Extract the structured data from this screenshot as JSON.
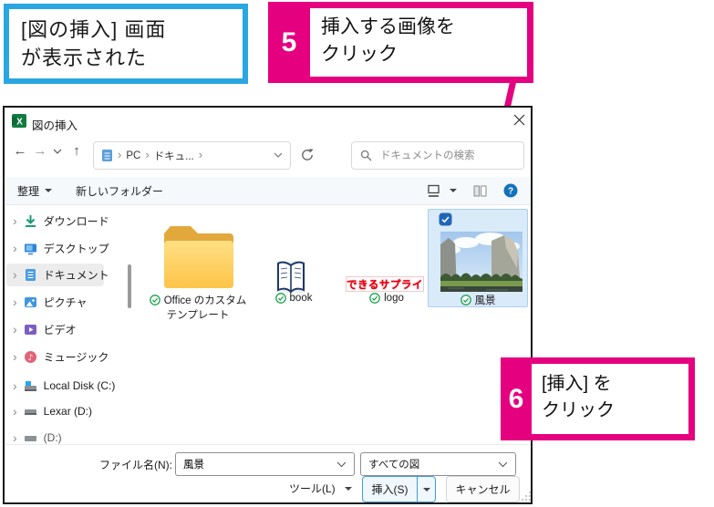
{
  "callout_note": {
    "line1": "[図の挿入] 画面",
    "line2": "が表示された"
  },
  "step5": {
    "number": "5",
    "line1": "挿入する画像を",
    "line2": "クリック"
  },
  "step6": {
    "number": "6",
    "line1": "[挿入] を",
    "line2": "クリック"
  },
  "dialog": {
    "title": "図の挿入",
    "nav": {
      "breadcrumb_root": "PC",
      "breadcrumb_folder": "ドキュ...",
      "search_placeholder": "ドキュメントの検索"
    },
    "toolbar": {
      "organize": "整理",
      "new_folder": "新しいフォルダー"
    },
    "sidebar": {
      "items": [
        {
          "label": "ダウンロード"
        },
        {
          "label": "デスクトップ"
        },
        {
          "label": "ドキュメント"
        },
        {
          "label": "ピクチャ"
        },
        {
          "label": "ビデオ"
        },
        {
          "label": "ミュージック"
        },
        {
          "label": "Local Disk (C:)"
        },
        {
          "label": "Lexar (D:)"
        },
        {
          "label": "(D:)"
        }
      ]
    },
    "files": {
      "folder_name_line1": "Office のカスタム",
      "folder_name_line2": "テンプレート",
      "book_name": "book",
      "logo_name": "logo",
      "logo_text": "できるサプライ",
      "photo_name": "風景"
    },
    "footer": {
      "filename_label": "ファイル名(N):",
      "filename_value": "風景",
      "filetype_value": "すべての図",
      "tools_label": "ツール(L)",
      "insert_label": "挿入(S)",
      "cancel_label": "キャンセル"
    }
  },
  "colors": {
    "accent_pink": "#e4007f",
    "callout_blue": "#29a7e2",
    "selection_blue": "#d9eaf9",
    "help_blue": "#1273bd",
    "excel_green": "#107c41"
  }
}
